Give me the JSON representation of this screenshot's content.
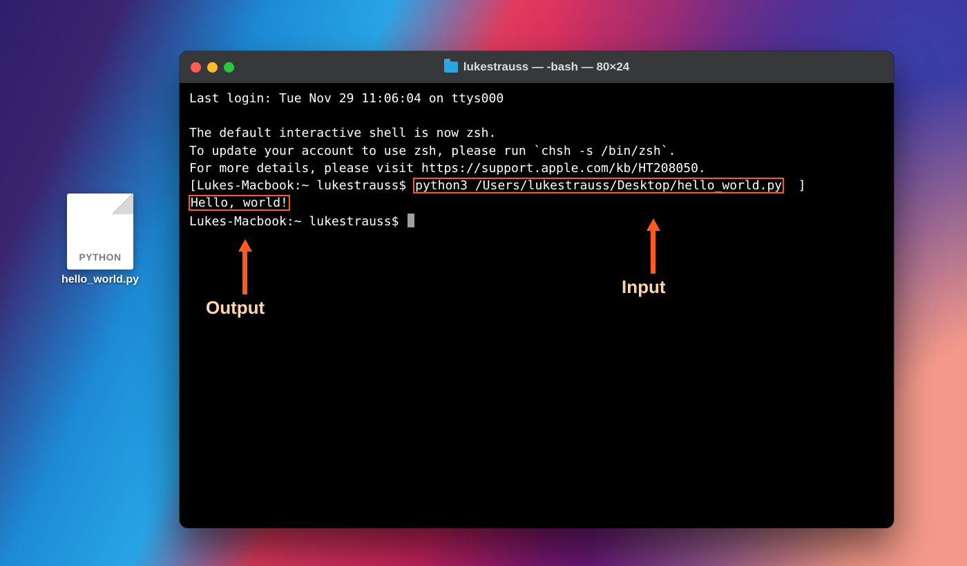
{
  "desktop": {
    "file_badge": "PYTHON",
    "file_name": "hello_world.py"
  },
  "window": {
    "title": "lukestrauss — -bash — 80×24"
  },
  "terminal": {
    "last_login": "Last login: Tue Nov 29 11:06:04 on ttys000",
    "msg1": "The default interactive shell is now zsh.",
    "msg2": "To update your account to use zsh, please run `chsh -s /bin/zsh`.",
    "msg3": "For more details, please visit https://support.apple.com/kb/HT208050.",
    "prompt_prefix": "[Lukes-Macbook:~ lukestrauss$ ",
    "command": "python3 /Users/lukestrauss/Desktop/hello_world.py",
    "prompt_suffix_bracket": "  ]",
    "output": "Hello, world!",
    "prompt2": "Lukes-Macbook:~ lukestrauss$ "
  },
  "annotations": {
    "output_label": "Output",
    "input_label": "Input"
  },
  "colors": {
    "highlight": "#ff5a1f",
    "annotation_text": "#ffd7aa"
  }
}
